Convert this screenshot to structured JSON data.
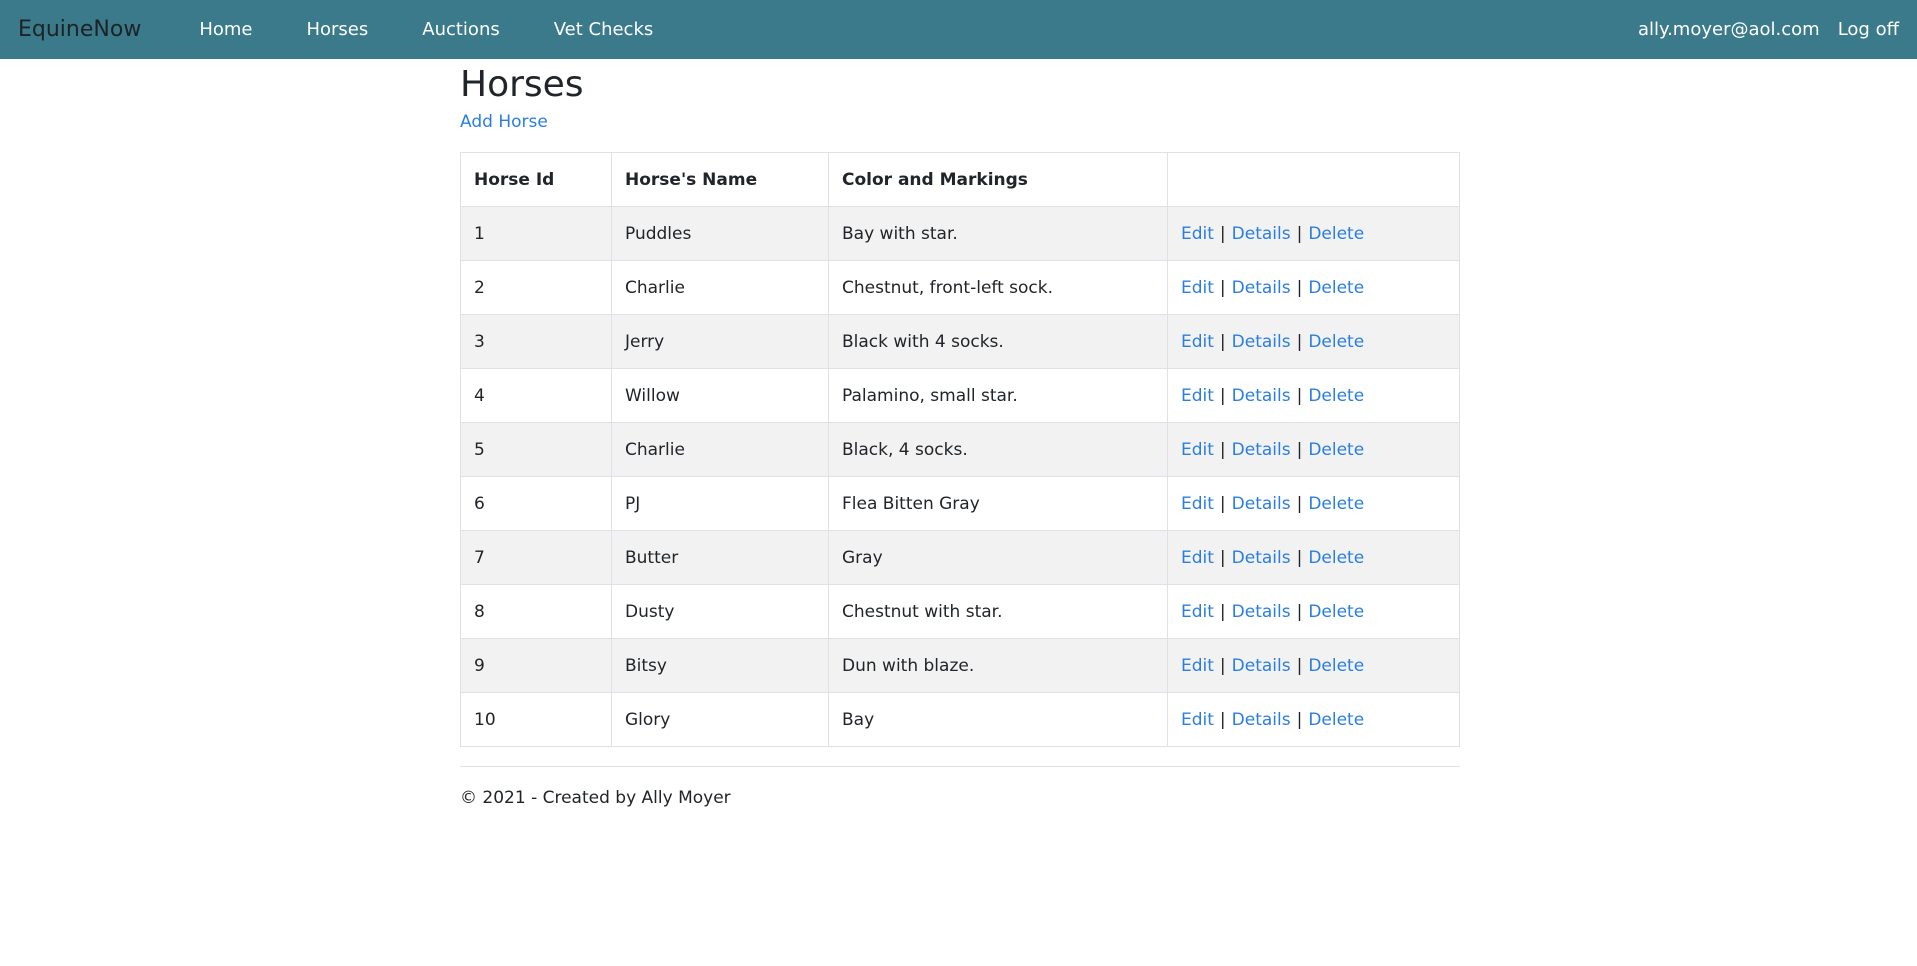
{
  "navbar": {
    "brand": "EquineNow",
    "links": [
      "Home",
      "Horses",
      "Auctions",
      "Vet Checks"
    ],
    "user_email": "ally.moyer@aol.com",
    "logoff": "Log off"
  },
  "page": {
    "title": "Horses",
    "add_link": "Add Horse"
  },
  "table": {
    "headers": [
      "Horse Id",
      "Horse's Name",
      "Color and Markings",
      ""
    ],
    "rows": [
      {
        "id": "1",
        "name": "Puddles",
        "color": "Bay with star."
      },
      {
        "id": "2",
        "name": "Charlie",
        "color": "Chestnut, front-left sock."
      },
      {
        "id": "3",
        "name": "Jerry",
        "color": "Black with 4 socks."
      },
      {
        "id": "4",
        "name": "Willow",
        "color": "Palamino, small star."
      },
      {
        "id": "5",
        "name": "Charlie",
        "color": "Black, 4 socks."
      },
      {
        "id": "6",
        "name": "PJ",
        "color": "Flea Bitten Gray"
      },
      {
        "id": "7",
        "name": "Butter",
        "color": "Gray"
      },
      {
        "id": "8",
        "name": "Dusty",
        "color": "Chestnut with star."
      },
      {
        "id": "9",
        "name": "Bitsy",
        "color": "Dun with blaze."
      },
      {
        "id": "10",
        "name": "Glory",
        "color": "Bay"
      }
    ],
    "actions": {
      "edit": "Edit",
      "details": "Details",
      "delete": "Delete",
      "separator": "|"
    }
  },
  "footer": {
    "text": "© 2021 - Created by Ally Moyer"
  },
  "colors": {
    "navbar_bg": "#3a7a8a",
    "link": "#2a7ee0",
    "striped_row": "#f2f2f2"
  }
}
